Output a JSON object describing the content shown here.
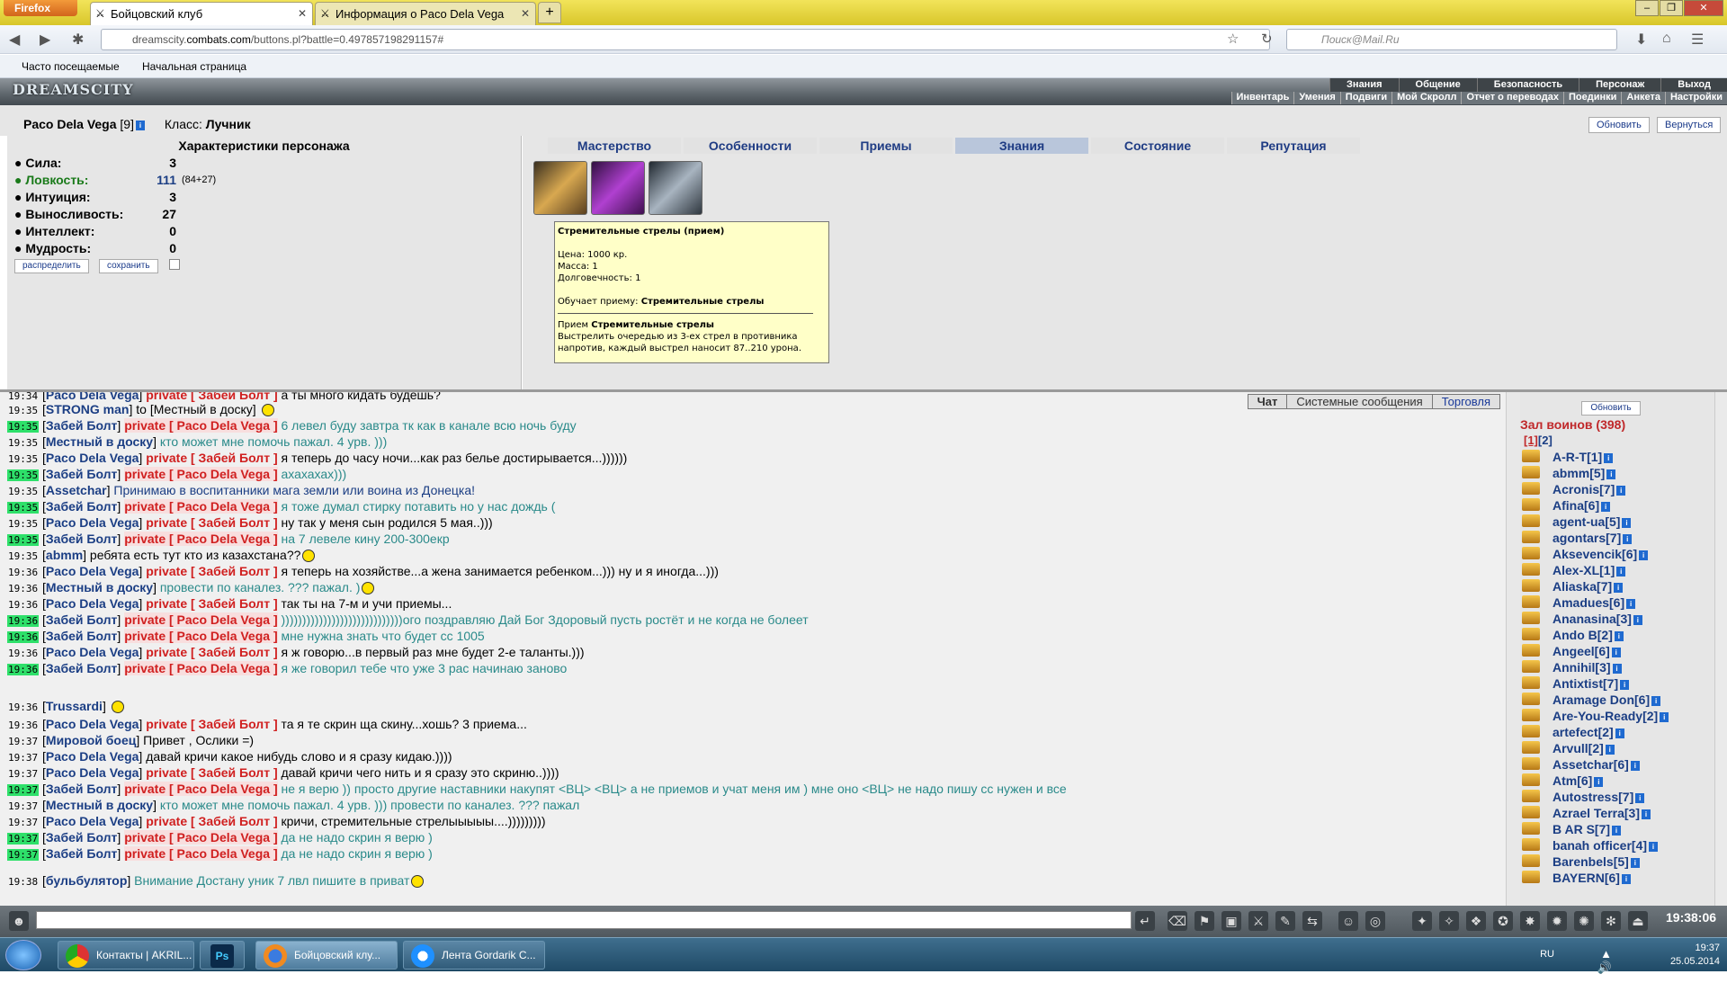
{
  "browser": {
    "menu_button": "Firefox",
    "tabs": [
      {
        "label": "Бойцовский клуб",
        "active": true
      },
      {
        "label": "Информация о Paco Dela Vega",
        "active": false
      }
    ],
    "url_prefix": "dreamscity.",
    "url_domain": "combats.com",
    "url_rest": "/buttons.pl?battle=0.497857198291157#",
    "search_placeholder": "Поиск@Mail.Ru",
    "bookmarks": [
      "Часто посещаемые",
      "Начальная страница"
    ]
  },
  "game": {
    "logo": "DREAMSCITY",
    "top_menu": [
      "Знания",
      "Общение",
      "Безопасность",
      "Персонаж",
      "Выход"
    ],
    "sub_menu": [
      "Инвентарь",
      "Умения",
      "Подвиги",
      "Мой Скролл",
      "Отчет о переводах",
      "Поединки",
      "Анкета",
      "Настройки"
    ],
    "character": {
      "name": "Paco Dela Vega",
      "level": "[9]",
      "class_label": "Класс:",
      "class_value": "Лучник",
      "refresh_button": "Обновить",
      "back_button": "Вернуться"
    },
    "stats_title": "Характеристики персонажа",
    "stats": [
      {
        "label": "Сила:",
        "value": "3",
        "extra": "",
        "highlight": false
      },
      {
        "label": "Ловкость:",
        "value": "111",
        "extra": "(84+27)",
        "highlight": true
      },
      {
        "label": "Интуиция:",
        "value": "3",
        "extra": "",
        "highlight": false
      },
      {
        "label": "Выносливость:",
        "value": "27",
        "extra": "",
        "highlight": false
      },
      {
        "label": "Интеллект:",
        "value": "0",
        "extra": "",
        "highlight": false
      },
      {
        "label": "Мудрость:",
        "value": "0",
        "extra": "",
        "highlight": false
      }
    ],
    "stat_buttons": [
      "распределить",
      "сохранить"
    ],
    "tabs": [
      "Мастерство",
      "Особенности",
      "Приемы",
      "Знания",
      "Состояние",
      "Репутация"
    ],
    "active_tab": "Знания",
    "tooltip": {
      "title": "Стремительные стрелы (прием)",
      "price": "Цена: 1000 кр.",
      "weight": "Масса: 1",
      "durability": "Долговечность: 1",
      "teaches_label": "Обучает приему:",
      "teaches_value": "Стремительные стрелы",
      "skill_label": "Прием",
      "skill_value": "Стремительные стрелы",
      "desc": "Выстрелить очередью из 3-ех стрел в противника напротив, каждый выстрел наносит 87..210 урона."
    }
  },
  "chat": {
    "tabs": [
      "Чат",
      "Системные сообщения",
      "Торговля"
    ],
    "lines": [
      {
        "time": "19:34",
        "h": false,
        "from": "Paco Dela Vega",
        "priv": "private [ Забей Болт ]",
        "text": "а ты много кидать будешь?"
      },
      {
        "time": "19:35",
        "h": false,
        "from": "STRONG man",
        "to": "to [Местный в доску]",
        "text": "",
        "smiley": true
      },
      {
        "time": "19:35",
        "h": true,
        "from": "Забей Болт",
        "priv": "private [ Paco Dela Vega ]",
        "text": "6 левел буду завтра тк как в канале всю ночь буду"
      },
      {
        "time": "19:35",
        "h": false,
        "from": "Местный в доску",
        "text": "кто может мне помочь пажал. 4 урв. )))"
      },
      {
        "time": "19:35",
        "h": false,
        "from": "Paco Dela Vega",
        "priv": "private [ Забей Болт ]",
        "text": "я теперь до часу ночи...как раз белье достирывается...))))))"
      },
      {
        "time": "19:35",
        "h": true,
        "from": "Забей Болт",
        "priv": "private [ Paco Dela Vega ]",
        "text": "ахахахах)))"
      },
      {
        "time": "19:35",
        "h": false,
        "from": "Assetchar",
        "text": "Принимаю в воспитанники мага земли или воина из Донецка!"
      },
      {
        "time": "19:35",
        "h": true,
        "from": "Забей Болт",
        "priv": "private [ Paco Dela Vega ]",
        "text": "я тоже думал стирку потавить но у нас дождь ("
      },
      {
        "time": "19:35",
        "h": false,
        "from": "Paco Dela Vega",
        "priv": "private [ Забей Болт ]",
        "text": "ну так у меня сын родился 5 мая..)))"
      },
      {
        "time": "19:35",
        "h": true,
        "from": "Забей Болт",
        "priv": "private [ Paco Dela Vega ]",
        "text": "на 7 левеле кину 200-300екр"
      },
      {
        "time": "19:35",
        "h": false,
        "from": "abmm",
        "text": "ребята есть тут кто из казахстана??",
        "smiley": true
      },
      {
        "time": "19:36",
        "h": false,
        "from": "Paco Dela Vega",
        "priv": "private [ Забей Болт ]",
        "text": "я теперь на хозяйстве...а жена занимается ребенком...))) ну и я иногда...)))"
      },
      {
        "time": "19:36",
        "h": false,
        "from": "Местный в доску",
        "text": "провести по каналез. ??? пажал. )",
        "smiley": true
      },
      {
        "time": "19:36",
        "h": false,
        "from": "Paco Dela Vega",
        "priv": "private [ Забей Болт ]",
        "text": "так ты на 7-м и учи приемы..."
      },
      {
        "time": "19:36",
        "h": true,
        "from": "Забей Болт",
        "priv": "private [ Paco Dela Vega ]",
        "text": ")))))))))))))))))))))))))))))ого поздравляю Дай Бог Здоровый пусть ростёт и не когда не болеет"
      },
      {
        "time": "19:36",
        "h": true,
        "from": "Забей Болт",
        "priv": "private [ Paco Dela Vega ]",
        "text": "мне нужна знать что будет сс 1005"
      },
      {
        "time": "19:36",
        "h": false,
        "from": "Paco Dela Vega",
        "priv": "private [ Забей Болт ]",
        "text": "я ж говорю...в первый раз мне будет 2-е таланты.)))"
      },
      {
        "time": "19:36",
        "h": true,
        "from": "Забей Болт",
        "priv": "private [ Paco Dela Vega ]",
        "text": "я же говорил тебе что уже 3 рас начинаю заново"
      },
      {
        "time": "19:36",
        "h": false,
        "from": "Trussardi",
        "text": "",
        "smiley": true
      },
      {
        "time": "19:36",
        "h": false,
        "from": "Paco Dela Vega",
        "priv": "private [ Забей Болт ]",
        "text": "та я те скрин ща скину...хошь? 3 приема..."
      },
      {
        "time": "19:37",
        "h": false,
        "from": "Мировой боец",
        "text": "Привет , Ослики =)"
      },
      {
        "time": "19:37",
        "h": false,
        "from": "Paco Dela Vega",
        "text": "давай кричи какое нибудь слово и я сразу кидаю.))))"
      },
      {
        "time": "19:37",
        "h": false,
        "from": "Paco Dela Vega",
        "priv": "private [ Забей Болт ]",
        "text": "давай кричи чего нить и я сразу это скриню..))))"
      },
      {
        "time": "19:37",
        "h": true,
        "from": "Забей Болт",
        "priv": "private [ Paco Dela Vega ]",
        "text": "не я верю )) просто другие наставники накупят <ВЦ> <ВЦ> а не приемов и учат меня им ) мне оно <ВЦ> не надо пишу сс нужен и все"
      },
      {
        "time": "19:37",
        "h": false,
        "from": "Местный в доску",
        "text": "кто может мне помочь пажал. 4 урв. ))) провести по каналез. ??? пажал"
      },
      {
        "time": "19:37",
        "h": false,
        "from": "Paco Dela Vega",
        "priv": "private [ Забей Болт ]",
        "text": "кричи, стремительные стрелыыыыы....)))))))))"
      },
      {
        "time": "19:37",
        "h": true,
        "from": "Забей Болт",
        "priv": "private [ Paco Dela Vega ]",
        "text": "да не надо скрин я верю )"
      },
      {
        "time": "19:37",
        "h": true,
        "from": "Забей Болт",
        "priv": "private [ Paco Dela Vega ]",
        "text": "да не надо скрин я верю )"
      },
      {
        "time": "19:38",
        "h": false,
        "from": "бульбулятор",
        "text": "Внимание Достану уник 7 лвл пишите в приват",
        "smiley": true
      }
    ]
  },
  "users": {
    "refresh": "Обновить",
    "title": "Зал воинов (398)",
    "pages": [
      "[1]",
      "[2]"
    ],
    "list": [
      "A-R-T[1]",
      "abmm[5]",
      "Acronis[7]",
      "Afina[6]",
      "agent-ua[5]",
      "agontars[7]",
      "Aksevencik[6]",
      "Alex-XL[1]",
      "Aliaska[7]",
      "Amadues[6]",
      "Ananasina[3]",
      "Ando B[2]",
      "Angeel[6]",
      "Annihil[3]",
      "Antixtist[7]",
      "Aramage Don[6]",
      "Are-You-Ready[2]",
      "artefect[2]",
      "Arvull[2]",
      "Assetchar[6]",
      "Atm[6]",
      "Autostress[7]",
      "Azrael Terra[3]",
      "B AR S[7]",
      "banah officer[4]",
      "Barenbels[5]",
      "BAYERN[6]"
    ]
  },
  "bottom": {
    "clock": "19:38:06"
  },
  "taskbar": {
    "items": [
      "Контакты | AKRIL...",
      "",
      "Бойцовский клу...",
      "Лента Gordarik C..."
    ],
    "lang": "RU",
    "time": "19:37",
    "date": "25.05.2014"
  }
}
